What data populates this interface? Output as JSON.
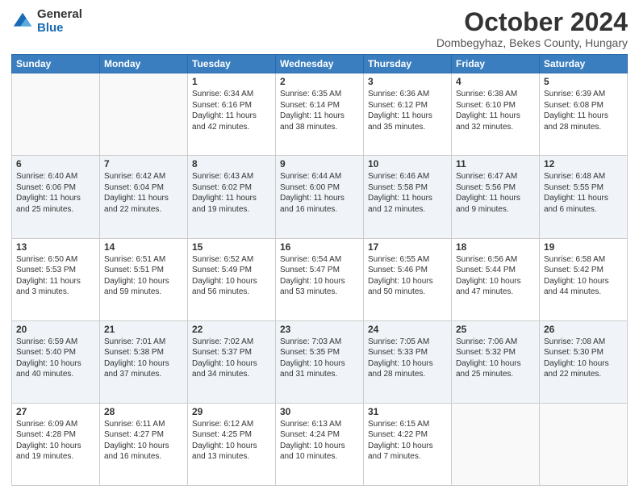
{
  "logo": {
    "general": "General",
    "blue": "Blue"
  },
  "header": {
    "title": "October 2024",
    "subtitle": "Dombegyhaz, Bekes County, Hungary"
  },
  "weekdays": [
    "Sunday",
    "Monday",
    "Tuesday",
    "Wednesday",
    "Thursday",
    "Friday",
    "Saturday"
  ],
  "weeks": [
    [
      {
        "day": "",
        "info": ""
      },
      {
        "day": "",
        "info": ""
      },
      {
        "day": "1",
        "info": "Sunrise: 6:34 AM\nSunset: 6:16 PM\nDaylight: 11 hours and 42 minutes."
      },
      {
        "day": "2",
        "info": "Sunrise: 6:35 AM\nSunset: 6:14 PM\nDaylight: 11 hours and 38 minutes."
      },
      {
        "day": "3",
        "info": "Sunrise: 6:36 AM\nSunset: 6:12 PM\nDaylight: 11 hours and 35 minutes."
      },
      {
        "day": "4",
        "info": "Sunrise: 6:38 AM\nSunset: 6:10 PM\nDaylight: 11 hours and 32 minutes."
      },
      {
        "day": "5",
        "info": "Sunrise: 6:39 AM\nSunset: 6:08 PM\nDaylight: 11 hours and 28 minutes."
      }
    ],
    [
      {
        "day": "6",
        "info": "Sunrise: 6:40 AM\nSunset: 6:06 PM\nDaylight: 11 hours and 25 minutes."
      },
      {
        "day": "7",
        "info": "Sunrise: 6:42 AM\nSunset: 6:04 PM\nDaylight: 11 hours and 22 minutes."
      },
      {
        "day": "8",
        "info": "Sunrise: 6:43 AM\nSunset: 6:02 PM\nDaylight: 11 hours and 19 minutes."
      },
      {
        "day": "9",
        "info": "Sunrise: 6:44 AM\nSunset: 6:00 PM\nDaylight: 11 hours and 16 minutes."
      },
      {
        "day": "10",
        "info": "Sunrise: 6:46 AM\nSunset: 5:58 PM\nDaylight: 11 hours and 12 minutes."
      },
      {
        "day": "11",
        "info": "Sunrise: 6:47 AM\nSunset: 5:56 PM\nDaylight: 11 hours and 9 minutes."
      },
      {
        "day": "12",
        "info": "Sunrise: 6:48 AM\nSunset: 5:55 PM\nDaylight: 11 hours and 6 minutes."
      }
    ],
    [
      {
        "day": "13",
        "info": "Sunrise: 6:50 AM\nSunset: 5:53 PM\nDaylight: 11 hours and 3 minutes."
      },
      {
        "day": "14",
        "info": "Sunrise: 6:51 AM\nSunset: 5:51 PM\nDaylight: 10 hours and 59 minutes."
      },
      {
        "day": "15",
        "info": "Sunrise: 6:52 AM\nSunset: 5:49 PM\nDaylight: 10 hours and 56 minutes."
      },
      {
        "day": "16",
        "info": "Sunrise: 6:54 AM\nSunset: 5:47 PM\nDaylight: 10 hours and 53 minutes."
      },
      {
        "day": "17",
        "info": "Sunrise: 6:55 AM\nSunset: 5:46 PM\nDaylight: 10 hours and 50 minutes."
      },
      {
        "day": "18",
        "info": "Sunrise: 6:56 AM\nSunset: 5:44 PM\nDaylight: 10 hours and 47 minutes."
      },
      {
        "day": "19",
        "info": "Sunrise: 6:58 AM\nSunset: 5:42 PM\nDaylight: 10 hours and 44 minutes."
      }
    ],
    [
      {
        "day": "20",
        "info": "Sunrise: 6:59 AM\nSunset: 5:40 PM\nDaylight: 10 hours and 40 minutes."
      },
      {
        "day": "21",
        "info": "Sunrise: 7:01 AM\nSunset: 5:38 PM\nDaylight: 10 hours and 37 minutes."
      },
      {
        "day": "22",
        "info": "Sunrise: 7:02 AM\nSunset: 5:37 PM\nDaylight: 10 hours and 34 minutes."
      },
      {
        "day": "23",
        "info": "Sunrise: 7:03 AM\nSunset: 5:35 PM\nDaylight: 10 hours and 31 minutes."
      },
      {
        "day": "24",
        "info": "Sunrise: 7:05 AM\nSunset: 5:33 PM\nDaylight: 10 hours and 28 minutes."
      },
      {
        "day": "25",
        "info": "Sunrise: 7:06 AM\nSunset: 5:32 PM\nDaylight: 10 hours and 25 minutes."
      },
      {
        "day": "26",
        "info": "Sunrise: 7:08 AM\nSunset: 5:30 PM\nDaylight: 10 hours and 22 minutes."
      }
    ],
    [
      {
        "day": "27",
        "info": "Sunrise: 6:09 AM\nSunset: 4:28 PM\nDaylight: 10 hours and 19 minutes."
      },
      {
        "day": "28",
        "info": "Sunrise: 6:11 AM\nSunset: 4:27 PM\nDaylight: 10 hours and 16 minutes."
      },
      {
        "day": "29",
        "info": "Sunrise: 6:12 AM\nSunset: 4:25 PM\nDaylight: 10 hours and 13 minutes."
      },
      {
        "day": "30",
        "info": "Sunrise: 6:13 AM\nSunset: 4:24 PM\nDaylight: 10 hours and 10 minutes."
      },
      {
        "day": "31",
        "info": "Sunrise: 6:15 AM\nSunset: 4:22 PM\nDaylight: 10 hours and 7 minutes."
      },
      {
        "day": "",
        "info": ""
      },
      {
        "day": "",
        "info": ""
      }
    ]
  ]
}
